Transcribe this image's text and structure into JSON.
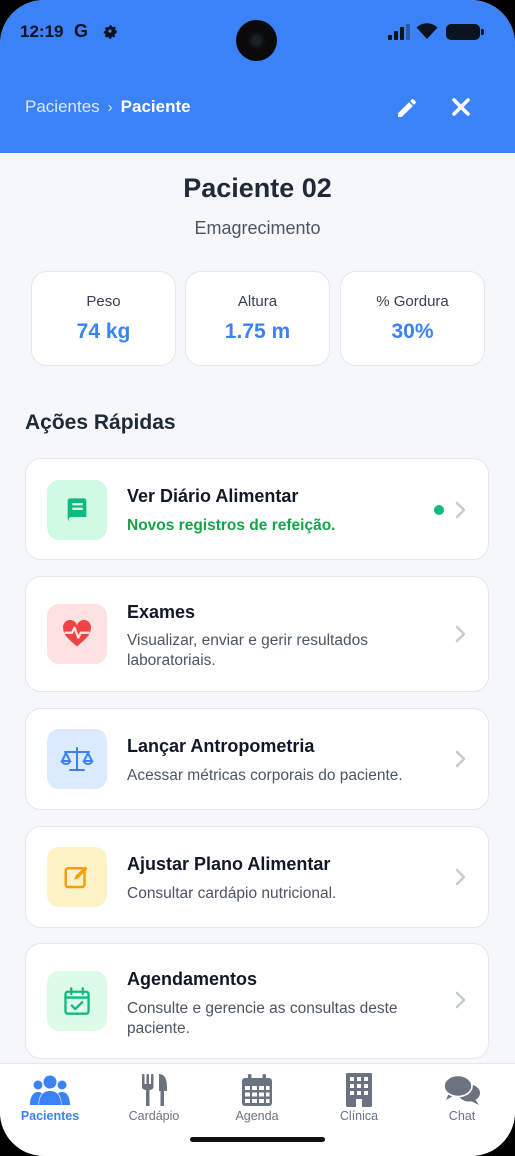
{
  "status": {
    "time": "12:19",
    "g_letter": "G"
  },
  "header": {
    "breadcrumb_parent": "Pacientes",
    "breadcrumb_separator": "›",
    "breadcrumb_current": "Paciente",
    "edit_icon": "pencil-icon",
    "close_icon": "close-icon"
  },
  "patient": {
    "name": "Paciente 02",
    "goal": "Emagrecimento"
  },
  "stats": [
    {
      "label": "Peso",
      "value": "74 kg"
    },
    {
      "label": "Altura",
      "value": "1.75 m"
    },
    {
      "label": "% Gordura",
      "value": "30%"
    }
  ],
  "quick_actions": {
    "title": "Ações Rápidas",
    "items": [
      {
        "title": "Ver Diário Alimentar",
        "desc": "Novos registros de refeição.",
        "icon": "book-icon",
        "color": "#10b981",
        "bg": "#d1fae5",
        "has_badge": true
      },
      {
        "title": "Exames",
        "desc": "Visualizar, enviar e gerir resultados laboratoriais.",
        "icon": "heartbeat-icon",
        "color": "#ef4444",
        "bg": "#fee2e2"
      },
      {
        "title": "Lançar Antropometria",
        "desc": "Acessar métricas corporais do paciente.",
        "icon": "scale-icon",
        "color": "#3b82f6",
        "bg": "#dbeafe"
      },
      {
        "title": "Ajustar Plano Alimentar",
        "desc": "Consultar cardápio nutricional.",
        "icon": "edit-square-icon",
        "color": "#f59e0b",
        "bg": "#fef3c7"
      },
      {
        "title": "Agendamentos",
        "desc": "Consulte e gerencie as consultas deste paciente.",
        "icon": "calendar-check-icon",
        "color": "#10b981",
        "bg": "#dcfce7"
      }
    ]
  },
  "nav": {
    "items": [
      {
        "label": "Pacientes",
        "icon": "users-icon",
        "active": true
      },
      {
        "label": "Cardápio",
        "icon": "utensils-icon"
      },
      {
        "label": "Agenda",
        "icon": "calendar-icon"
      },
      {
        "label": "Clínica",
        "icon": "building-icon"
      },
      {
        "label": "Chat",
        "icon": "chat-icon"
      }
    ]
  },
  "colors": {
    "primary": "#3b82f6",
    "success": "#10b981"
  }
}
